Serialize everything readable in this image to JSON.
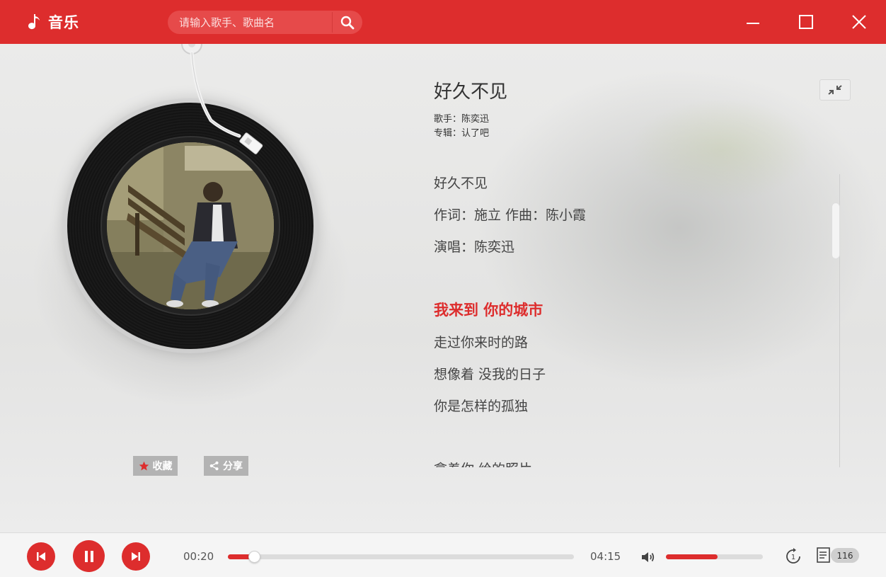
{
  "app": {
    "title": "音乐"
  },
  "search": {
    "placeholder": "请输入歌手、歌曲名"
  },
  "song": {
    "title": "好久不见",
    "artist_line": "歌手：陈奕迅",
    "album_line": "专辑：认了吧"
  },
  "actions": {
    "favorite_label": "收藏",
    "share_label": "分享"
  },
  "lyrics": {
    "lines": [
      "好久不见",
      "作词：施立 作曲：陈小霞",
      "演唱：陈奕迅",
      "我来到 你的城市",
      "走过你来时的路",
      "想像着 没我的日子",
      "你是怎样的孤独",
      "拿着你 给的照片"
    ],
    "current_index": 3
  },
  "player": {
    "elapsed": "00:20",
    "duration": "04:15",
    "progress_fraction": 0.075,
    "volume_fraction": 0.53,
    "playlist_count": "116"
  },
  "colors": {
    "accent": "#dd2d2d",
    "text": "#333333"
  },
  "icons": {
    "logo": "music-note-icon",
    "search": "search-icon",
    "minimize": "minimize-icon",
    "maximize": "maximize-icon",
    "close": "close-icon",
    "collapse": "collapse-icon",
    "favorite": "star-icon",
    "share": "share-icon",
    "prev": "skip-previous-icon",
    "pause": "pause-icon",
    "next": "skip-next-icon",
    "volume": "volume-icon",
    "loop": "repeat-one-icon",
    "playlist": "playlist-icon"
  }
}
